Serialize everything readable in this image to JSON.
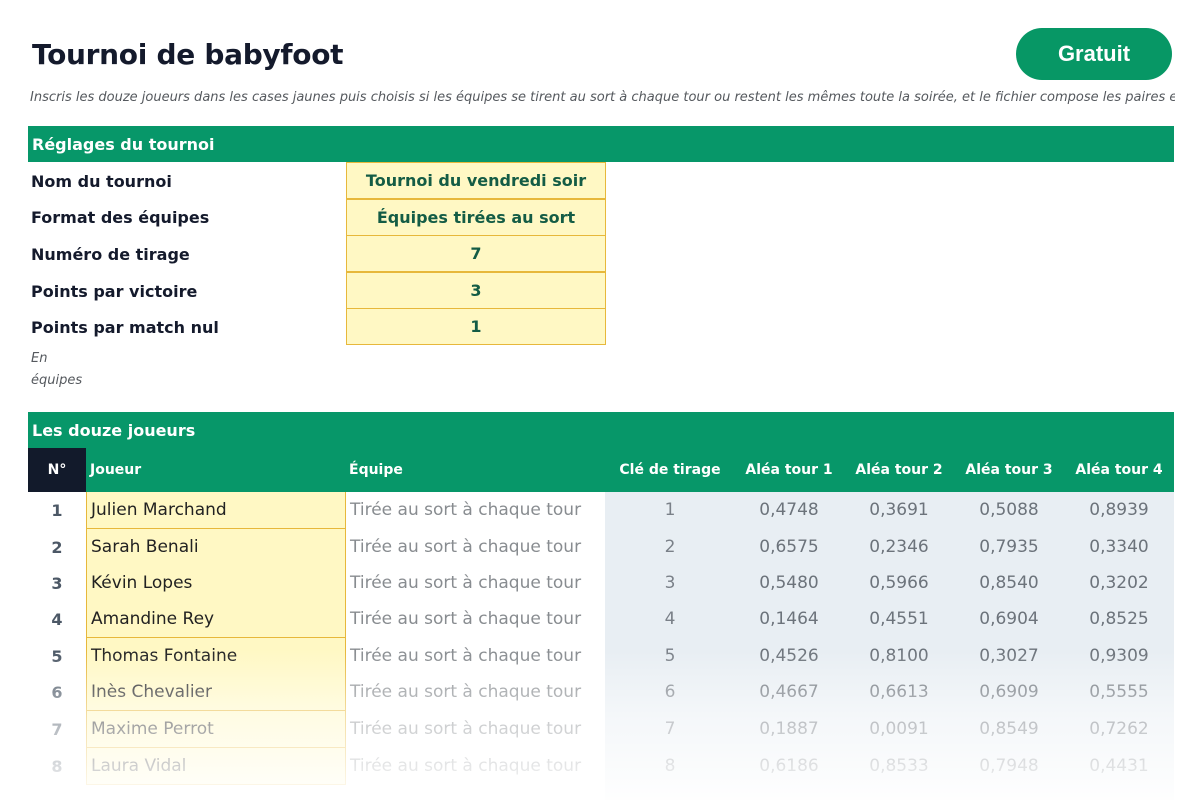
{
  "header": {
    "title": "Tournoi de babyfoot",
    "cta_label": "Gratuit",
    "intro": "Inscris les douze joueurs dans les cases jaunes puis choisis si les équipes se tirent au sort à chaque tour ou restent les mêmes toute la soirée, et le fichier compose les paires e"
  },
  "settings": {
    "section_title": "Réglages du tournoi",
    "rows": [
      {
        "label": "Nom du tournoi",
        "value": "Tournoi du vendredi soir"
      },
      {
        "label": "Format des équipes",
        "value": "Équipes tirées au sort"
      },
      {
        "label": "Numéro de tirage",
        "value": "7"
      },
      {
        "label": "Points par victoire",
        "value": "3"
      },
      {
        "label": "Points par match nul",
        "value": "1"
      }
    ],
    "note": "En équipes"
  },
  "players": {
    "section_title": "Les douze joueurs",
    "columns": {
      "num": "N°",
      "player": "Joueur",
      "team": "Équipe",
      "key": "Clé de tirage",
      "r1": "Aléa tour 1",
      "r2": "Aléa tour 2",
      "r3": "Aléa tour 3",
      "r4": "Aléa tour 4"
    },
    "rows": [
      {
        "num": "1",
        "name": "Julien Marchand",
        "team": "Tirée au sort à chaque tour",
        "key": "1",
        "r1": "0,4748",
        "r2": "0,3691",
        "r3": "0,5088",
        "r4": "0,8939"
      },
      {
        "num": "2",
        "name": "Sarah Benali",
        "team": "Tirée au sort à chaque tour",
        "key": "2",
        "r1": "0,6575",
        "r2": "0,2346",
        "r3": "0,7935",
        "r4": "0,3340"
      },
      {
        "num": "3",
        "name": "Kévin Lopes",
        "team": "Tirée au sort à chaque tour",
        "key": "3",
        "r1": "0,5480",
        "r2": "0,5966",
        "r3": "0,8540",
        "r4": "0,3202"
      },
      {
        "num": "4",
        "name": "Amandine Rey",
        "team": "Tirée au sort à chaque tour",
        "key": "4",
        "r1": "0,1464",
        "r2": "0,4551",
        "r3": "0,6904",
        "r4": "0,8525"
      },
      {
        "num": "5",
        "name": "Thomas Fontaine",
        "team": "Tirée au sort à chaque tour",
        "key": "5",
        "r1": "0,4526",
        "r2": "0,8100",
        "r3": "0,3027",
        "r4": "0,9309"
      },
      {
        "num": "6",
        "name": "Inès Chevalier",
        "team": "Tirée au sort à chaque tour",
        "key": "6",
        "r1": "0,4667",
        "r2": "0,6613",
        "r3": "0,6909",
        "r4": "0,5555"
      },
      {
        "num": "7",
        "name": "Maxime Perrot",
        "team": "Tirée au sort à chaque tour",
        "key": "7",
        "r1": "0,1887",
        "r2": "0,0091",
        "r3": "0,8549",
        "r4": "0,7262"
      },
      {
        "num": "8",
        "name": "Laura Vidal",
        "team": "Tirée au sort à chaque tour",
        "key": "8",
        "r1": "0,6186",
        "r2": "0,8533",
        "r3": "0,7948",
        "r4": "0,4431"
      }
    ]
  }
}
